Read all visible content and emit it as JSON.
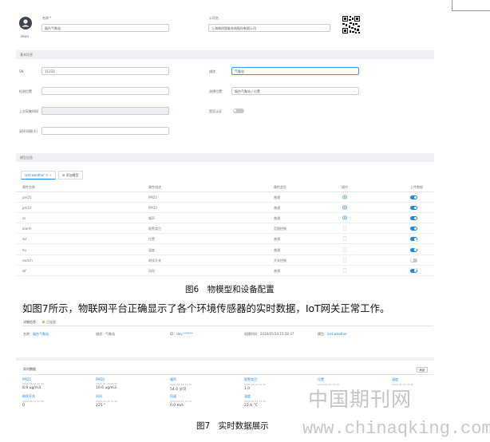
{
  "fig6": {
    "avatar_label": "dean",
    "name_label": "名称 *",
    "name_value": "烟台气象站",
    "company_label": "公司名",
    "company_value": "上海南科智能系统股份有限公司",
    "section_basic": "基本信息",
    "sn_label": "SN",
    "sn_value": "11233",
    "desc_label": "描述",
    "desc_value": "气象站",
    "install_label": "检测位置",
    "location_label": "选择位置",
    "location_value": "烟台气象站 / 位置",
    "last_report_label": "上次采集时间",
    "realtime_label": "是否认证",
    "interval_label": "采样间隔(天)",
    "section_model": "模型信息",
    "tab_active": "iost.weather",
    "tab_add": "添加模型",
    "columns": [
      "属性名称",
      "属性描述",
      "属性类型",
      "操作",
      "上传数据"
    ],
    "rows": [
      {
        "name": "pm25",
        "desc": "PM25",
        "type": "普通",
        "icon": true,
        "on": true
      },
      {
        "name": "pm10",
        "desc": "PM10",
        "type": "普通",
        "icon": true,
        "on": true
      },
      {
        "name": "zs",
        "desc": "噪声",
        "type": "普通",
        "icon": true,
        "on": true
      },
      {
        "name": "alarm",
        "desc": "报警类目",
        "type": "范围控制",
        "icon": false,
        "on": true
      },
      {
        "name": "wz",
        "desc": "位置",
        "type": "普通",
        "icon": false,
        "on": true
      },
      {
        "name": "hu",
        "desc": "湿度",
        "type": "普通",
        "icon": false,
        "on": true
      },
      {
        "name": "switch",
        "desc": "继续开关",
        "type": "开关控制",
        "icon": false,
        "on": false
      },
      {
        "name": "wf",
        "desc": "风向",
        "type": "普通",
        "icon": false,
        "on": true
      }
    ],
    "caption": "图6　物模型和设备配置"
  },
  "body_text": "如图7所示，物联网平台正确显示了各个环境传感器的实时数据，IoT网关正常工作。",
  "fig7": {
    "detail_title": "详细信息",
    "status": "已连接",
    "name_label": "名称：",
    "name_value": "烟台气象站",
    "desc_text": "描述：气象站",
    "id_label": "ID：",
    "id_value": "dev.******",
    "created_text": "创建时间：2020/05/14 15:28:37",
    "model_label": "模型：",
    "model_value": "iost.weather",
    "realtime_title": "实时数据",
    "refresh_btn": "刷新",
    "metrics": [
      {
        "name": "PM25",
        "time": "2020-05-14 15:30",
        "value": "8.9 ug/m3"
      },
      {
        "name": "PM10",
        "time": "2020-05-14 15:30",
        "value": "10.6 ug/m3"
      },
      {
        "name": "噪声",
        "time": "2020-05-14 15:30",
        "value": "54.0 分贝"
      },
      {
        "name": "报警类目",
        "time": "2020-05-14 15:30",
        "value": "1.0"
      },
      {
        "name": "位置",
        "time": "2020-05-14 15:30",
        "value": ""
      },
      {
        "name": "湿度",
        "time": "2020-05-14 15:30",
        "value": ""
      },
      {
        "name": "继续开关",
        "time": "2020-05-14 15:30",
        "value": "0"
      },
      {
        "name": "风向",
        "time": "2020-05-14 15:30",
        "value": "225 °"
      },
      {
        "name": "风速",
        "time": "2020-05-14 15:30",
        "value": "0.0 m/s"
      },
      {
        "name": "温度",
        "time": "2020-05-14 15:30",
        "value": "22.6 °C"
      }
    ],
    "caption": "图7　实时数据展示"
  },
  "watermark_cn": "中国期刊网",
  "watermark_url": "www.chinaqking.com"
}
